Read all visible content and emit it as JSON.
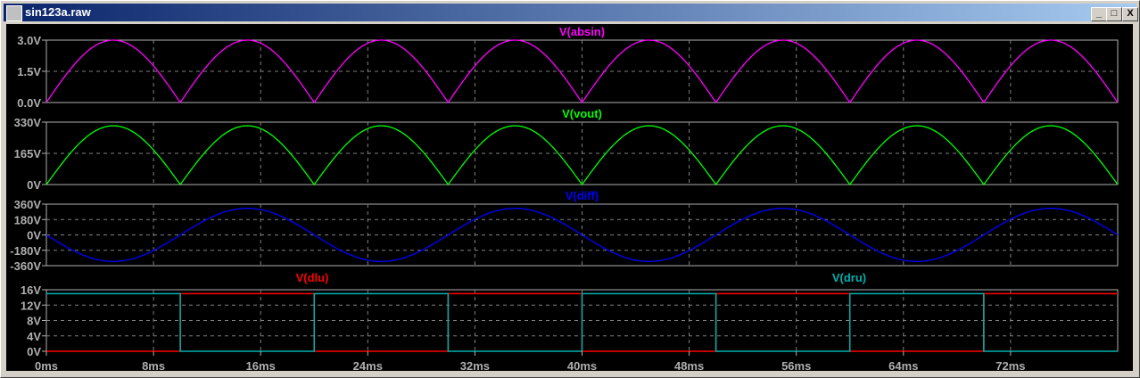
{
  "window": {
    "title": "sin123a.raw",
    "buttons": {
      "minimize": "_",
      "maximize": "□",
      "close": "X"
    }
  },
  "chart_data": [
    {
      "type": "line",
      "title": "V(absin)",
      "color": "#ff00ff",
      "function": "abs_sine",
      "amplitude": 3.0,
      "frequency_hz": 50,
      "ylim": [
        0,
        3
      ],
      "yticks": [
        "3.0V",
        "1.5V",
        "0.0V"
      ],
      "ytick_values": [
        3,
        1.5,
        0
      ]
    },
    {
      "type": "line",
      "title": "V(vout)",
      "color": "#00ff00",
      "function": "abs_sine",
      "amplitude": 311,
      "frequency_hz": 50,
      "ylim": [
        0,
        330
      ],
      "yticks": [
        "330V",
        "165V",
        "0V"
      ],
      "ytick_values": [
        330,
        165,
        0
      ]
    },
    {
      "type": "line",
      "title": "V(diff)",
      "color": "#0000ff",
      "function": "neg_sine",
      "amplitude": 311,
      "frequency_hz": 50,
      "ylim": [
        -360,
        360
      ],
      "yticks": [
        "360V",
        "180V",
        "0V",
        "-180V",
        "-360V"
      ],
      "ytick_values": [
        360,
        180,
        0,
        -180,
        -360
      ]
    },
    {
      "type": "line",
      "title": "V(dlu) / V(dru)",
      "ylim": [
        0,
        16
      ],
      "yticks": [
        "16V",
        "12V",
        "8V",
        "4V",
        "0V"
      ],
      "ytick_values": [
        16,
        12,
        8,
        4,
        0
      ],
      "series": [
        {
          "name": "V(dlu)",
          "color": "#ff0000",
          "function": "square",
          "high": 15,
          "period_ms": 20,
          "high_phase": "second_half"
        },
        {
          "name": "V(dru)",
          "color": "#00b0b0",
          "function": "square",
          "high": 15,
          "period_ms": 20,
          "high_phase": "first_half"
        }
      ]
    }
  ],
  "x_axis": {
    "xlim_ms": [
      0,
      80
    ],
    "ticks": [
      "0ms",
      "8ms",
      "16ms",
      "24ms",
      "32ms",
      "40ms",
      "48ms",
      "56ms",
      "64ms",
      "72ms"
    ],
    "tick_values": [
      0,
      8,
      16,
      24,
      32,
      40,
      48,
      56,
      64,
      72
    ]
  }
}
